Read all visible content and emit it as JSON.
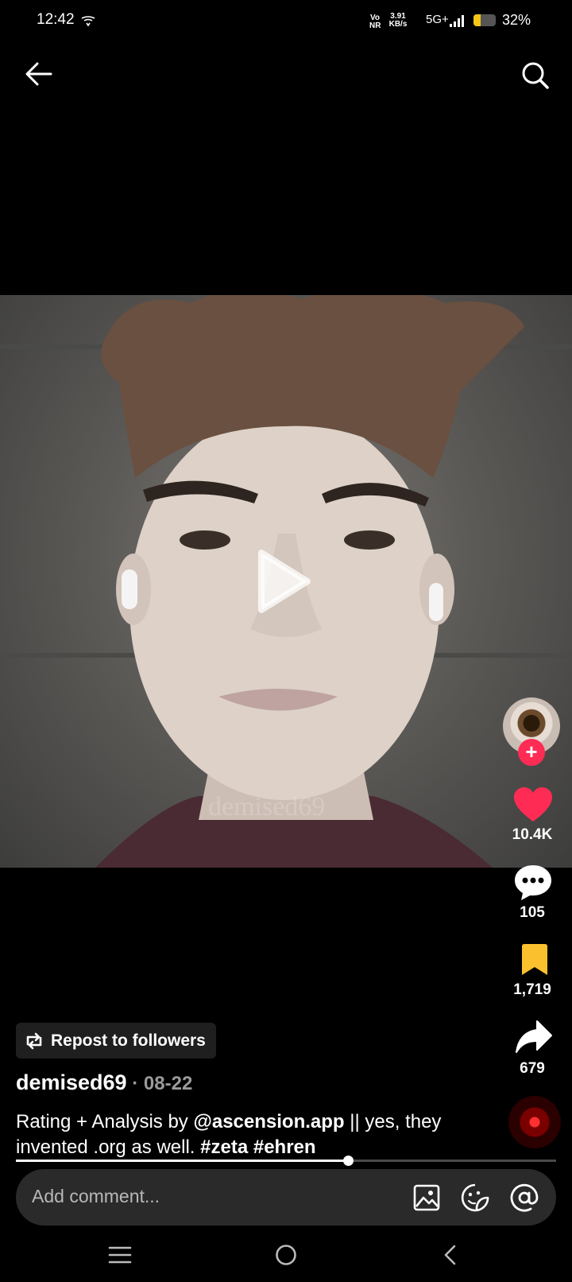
{
  "status_bar": {
    "time": "12:42",
    "vo": "Vo",
    "nr": "NR",
    "speed_value": "3.91",
    "speed_unit": "KB/s",
    "network": "5G+",
    "battery_percent": "32%",
    "battery_level": 0.32,
    "battery_color": "#f5c518"
  },
  "header": {
    "back_icon": "arrow-left-icon",
    "search_icon": "search-icon"
  },
  "video": {
    "watermark": "demised69",
    "play_icon": "play-icon"
  },
  "actions": {
    "follow_icon": "plus-icon",
    "like_count": "10.4K",
    "like_color": "#fe2c55",
    "comment_count": "105",
    "save_count": "1,719",
    "save_color": "#fbc02d",
    "share_count": "679"
  },
  "post": {
    "repost_label": "Repost to followers",
    "username": "demised69",
    "date": " · 08-22",
    "caption_1": "Rating + Analysis by ",
    "caption_mention": "@ascension.app",
    "caption_2": " || yes, they invented .org as well. ",
    "caption_tag1": "#zeta",
    "caption_tag2": "#ehren"
  },
  "progress": {
    "played_fraction": 0.615
  },
  "comment_bar": {
    "placeholder": "Add comment..."
  },
  "navigation": {
    "recents_icon": "menu-lines-icon",
    "home_icon": "circle-home-icon",
    "back_icon": "chevron-left-icon"
  }
}
